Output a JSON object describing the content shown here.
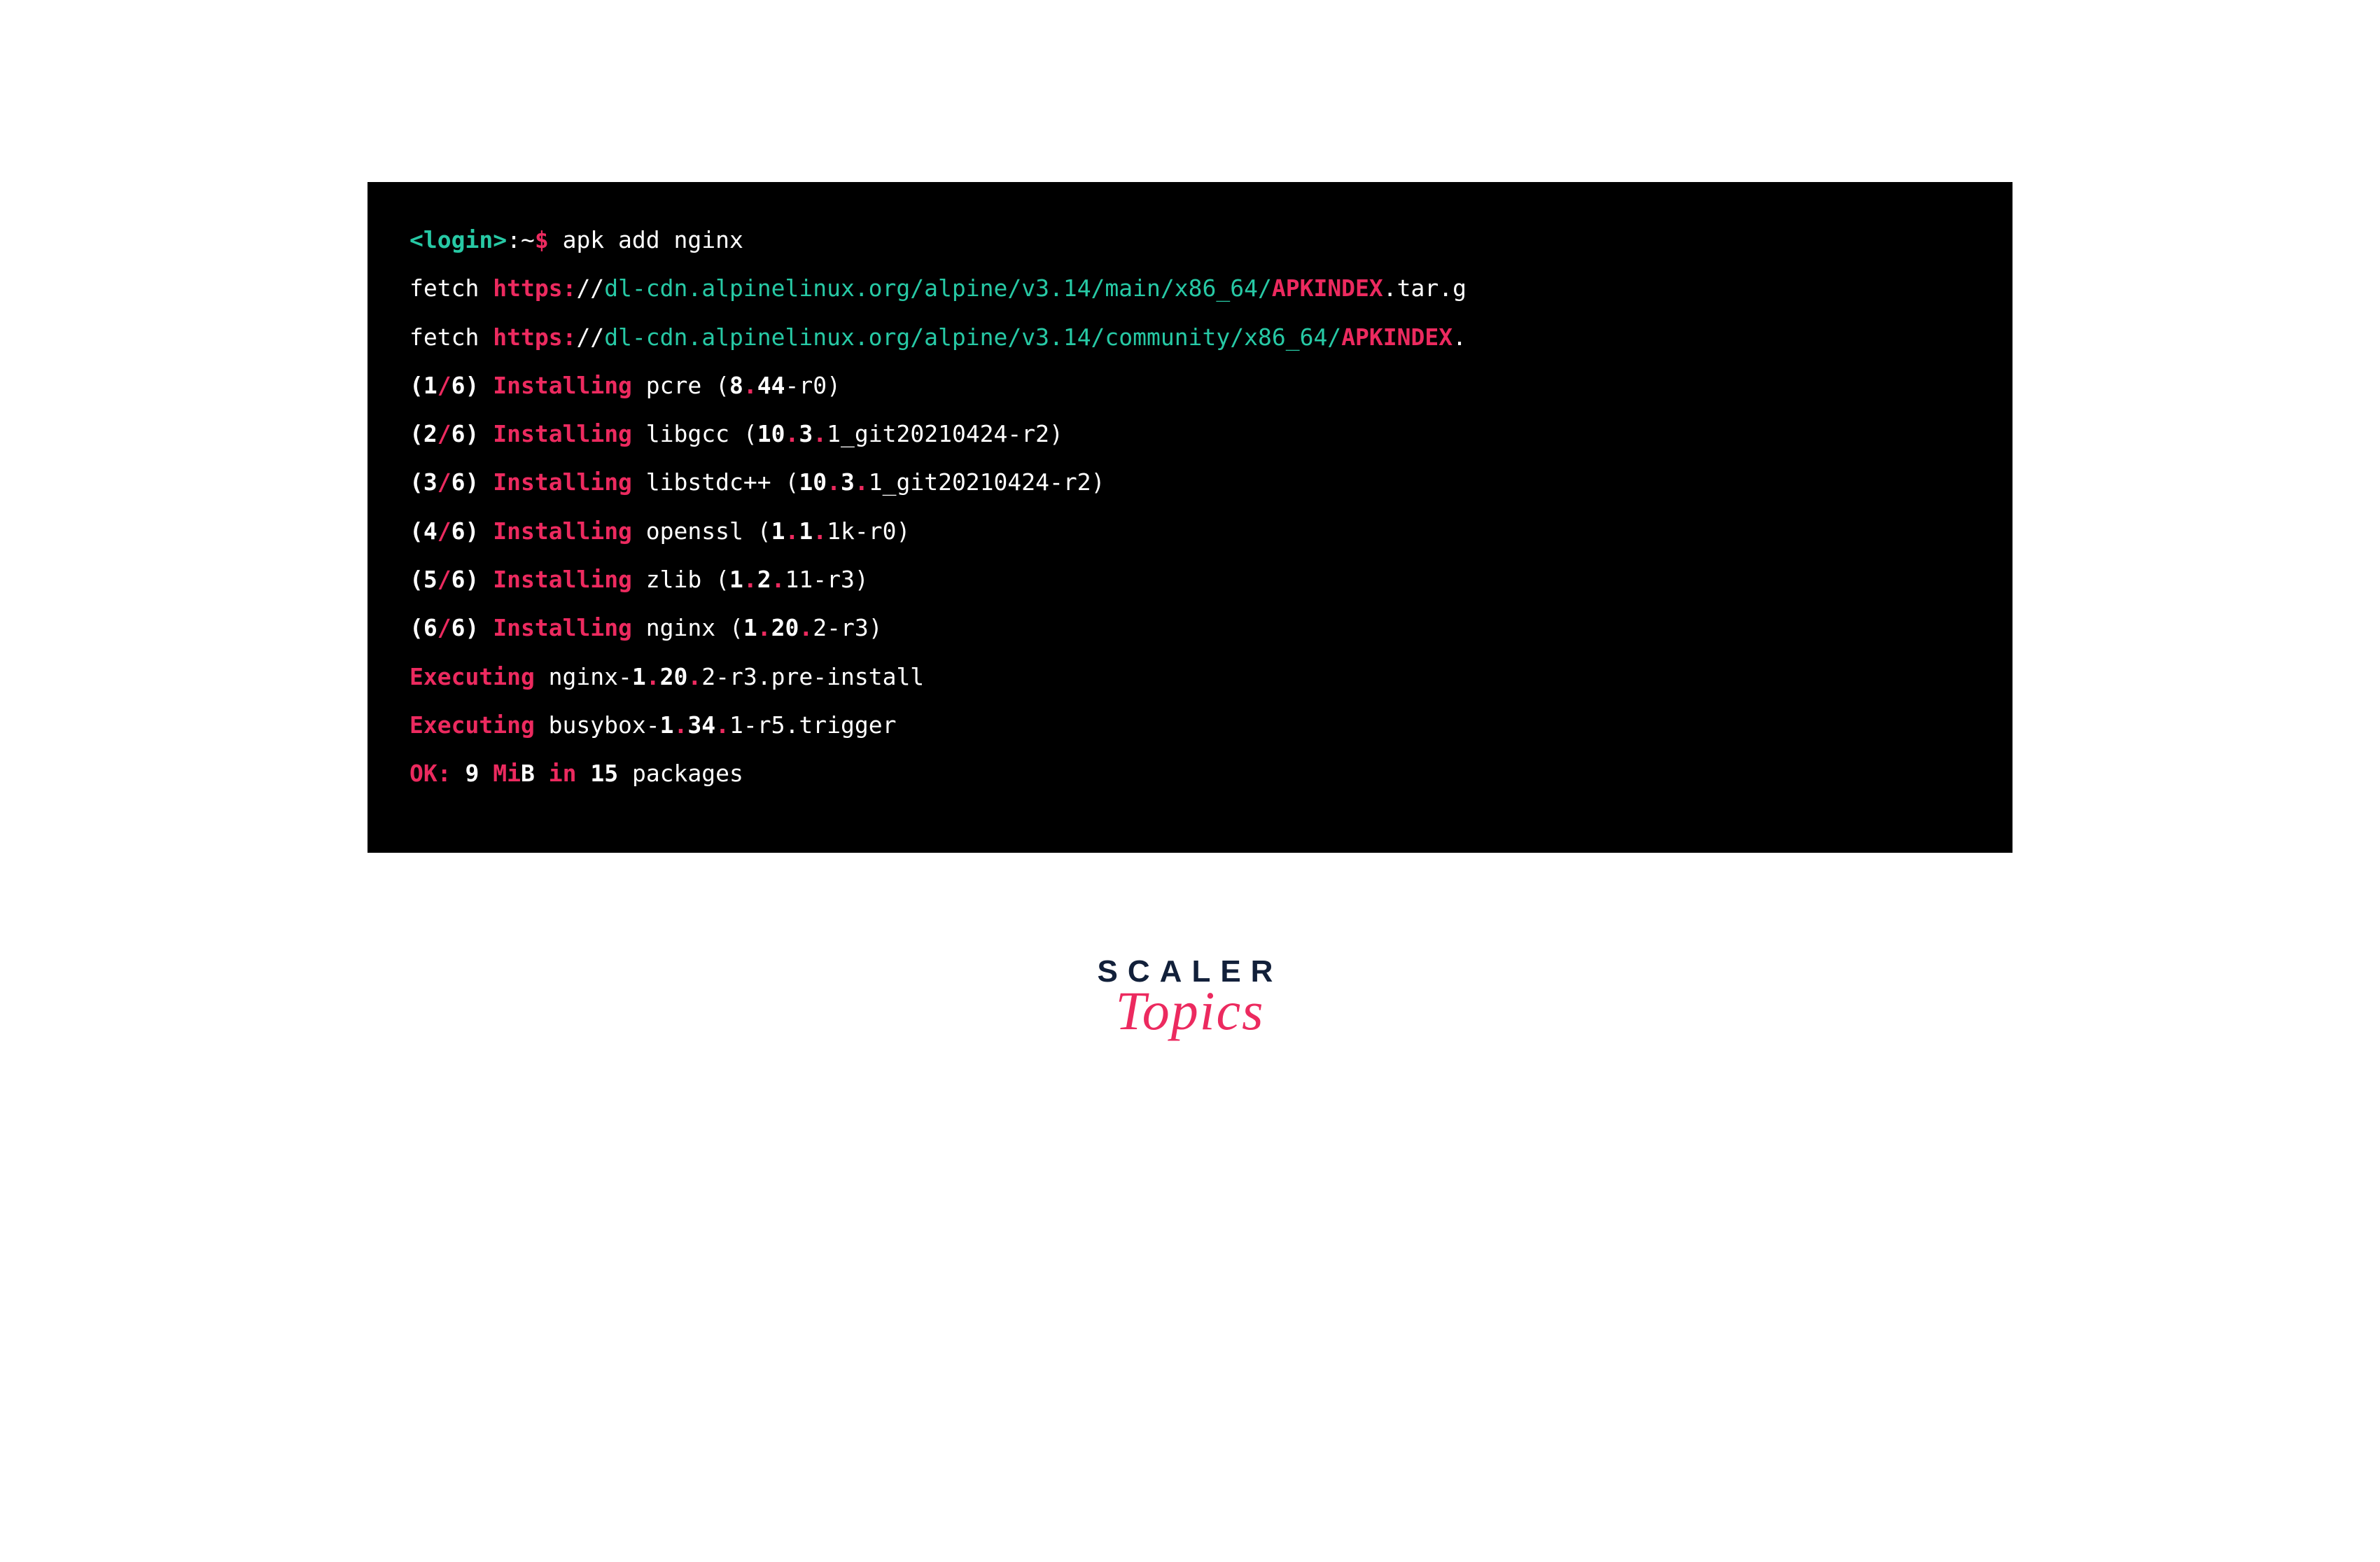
{
  "prompt": {
    "user": "<login>",
    "colon": ":",
    "path": "~",
    "dollar": "$",
    "command": " apk add nginx"
  },
  "fetch": [
    {
      "label": "fetch ",
      "scheme": "https:",
      "sep": "//",
      "path": "dl-cdn.alpinelinux.org/alpine/v3.14/main/x86_64/",
      "file_red": "APKINDEX",
      "file_wh": ".tar.g"
    },
    {
      "label": "fetch ",
      "scheme": "https:",
      "sep": "//",
      "path": "dl-cdn.alpinelinux.org/alpine/v3.14/community/x86_64/",
      "file_red": "APKINDEX",
      "file_wh": "."
    }
  ],
  "installs": [
    {
      "idx": "1",
      "total": "6",
      "action": "Installing",
      "name": " pcre ",
      "v1": "8",
      "d1": ".",
      "v2": "44",
      "dash": "-",
      "rev": "r0"
    },
    {
      "idx": "2",
      "total": "6",
      "action": "Installing",
      "name": " libgcc ",
      "v1": "10",
      "d1": ".",
      "v2": "3",
      "d2": ".",
      "v3": "1_git20210424",
      "dash": "-",
      "rev": "r2"
    },
    {
      "idx": "3",
      "total": "6",
      "action": "Installing",
      "name": " libstdc++ ",
      "v1": "10",
      "d1": ".",
      "v2": "3",
      "d2": ".",
      "v3": "1_git20210424",
      "dash": "-",
      "rev": "r2"
    },
    {
      "idx": "4",
      "total": "6",
      "action": "Installing",
      "name": " openssl ",
      "v1": "1",
      "d1": ".",
      "v2": "1",
      "d2": ".",
      "v3": "1k",
      "dash": "-",
      "rev": "r0"
    },
    {
      "idx": "5",
      "total": "6",
      "action": "Installing",
      "name": " zlib ",
      "v1": "1",
      "d1": ".",
      "v2": "2",
      "d2": ".",
      "v3": "11",
      "dash": "-",
      "rev": "r3"
    },
    {
      "idx": "6",
      "total": "6",
      "action": "Installing",
      "name": " nginx ",
      "v1": "1",
      "d1": ".",
      "v2": "20",
      "d2": ".",
      "v3": "2",
      "dash": "-",
      "rev": "r3"
    }
  ],
  "executing": [
    {
      "label": "Executing",
      "arg_a": " nginx-",
      "v1": "1",
      "d1": ".",
      "v2": "20",
      "d2": ".",
      "v3": "2",
      "dash": "-",
      "rev": "r3",
      "suffix": ".pre-install"
    },
    {
      "label": "Executing",
      "arg_a": " busybox-",
      "v1": "1",
      "d1": ".",
      "v2": "34",
      "d2": ".",
      "v3": "1",
      "dash": "-",
      "rev": "r5",
      "suffix": ".trigger"
    }
  ],
  "summary": {
    "ok": "OK:",
    "size": " 9 ",
    "mib": "Mi",
    "mib_b": "B",
    "in": " in ",
    "count": "15",
    "packages": " packages"
  },
  "logo": {
    "scaler": "SCALER",
    "topics": "Topics"
  }
}
